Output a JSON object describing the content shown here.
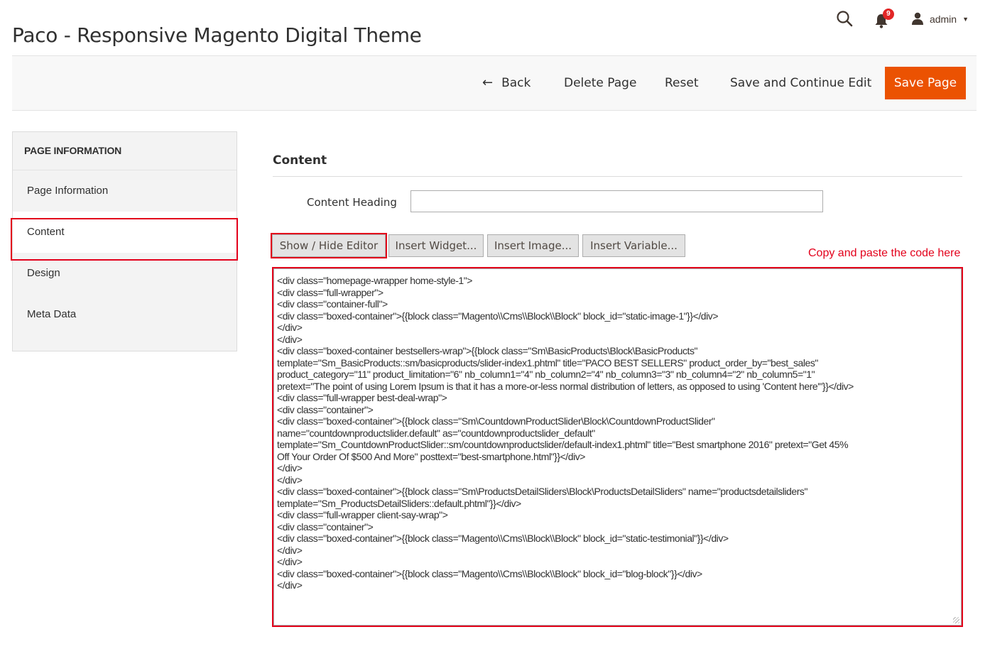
{
  "header": {
    "title": "Paco - Responsive Magento Digital Theme",
    "notifications_count": "9",
    "user_name": "admin"
  },
  "toolbar": {
    "back_label": "Back",
    "delete_label": "Delete Page",
    "reset_label": "Reset",
    "save_continue_label": "Save and Continue Edit",
    "save_label": "Save Page"
  },
  "sidebar": {
    "title": "PAGE INFORMATION",
    "items": [
      {
        "label": "Page Information"
      },
      {
        "label": "Content"
      },
      {
        "label": "Design"
      },
      {
        "label": "Meta Data"
      }
    ],
    "active_index": 1
  },
  "content": {
    "section_title": "Content",
    "heading_label": "Content Heading",
    "heading_value": "",
    "editor_buttons": {
      "show_hide": "Show / Hide Editor",
      "widget": "Insert Widget...",
      "image": "Insert Image...",
      "variable": "Insert Variable..."
    },
    "annotation": "Copy and paste the code here",
    "code": "<div class=\"homepage-wrapper home-style-1\">\n<div class=\"full-wrapper\">\n<div class=\"container-full\">\n<div class=\"boxed-container\">{{block class=\"Magento\\\\Cms\\\\Block\\\\Block\" block_id=\"static-image-1\"}}</div>\n</div>\n</div>\n<div class=\"boxed-container bestsellers-wrap\">{{block class=\"Sm\\BasicProducts\\Block\\BasicProducts\"\ntemplate=\"Sm_BasicProducts::sm/basicproducts/slider-index1.phtml\" title=\"PACO BEST SELLERS\" product_order_by=\"best_sales\"\nproduct_category=\"11\" product_limitation=\"6\" nb_column1=\"4\" nb_column2=\"4\" nb_column3=\"3\" nb_column4=\"2\" nb_column5=\"1\"\npretext=\"The point of using Lorem Ipsum is that it has a more-or-less normal distribution of letters, as opposed to using 'Content here'\"}}</div>\n<div class=\"full-wrapper best-deal-wrap\">\n<div class=\"container\">\n<div class=\"boxed-container\">{{block class=\"Sm\\CountdownProductSlider\\Block\\CountdownProductSlider\"\nname=\"countdownproductslider.default\" as=\"countdownproductslider_default\"\ntemplate=\"Sm_CountdownProductSlider::sm/countdownproductslider/default-index1.phtml\" title=\"Best smartphone 2016\" pretext=\"Get 45%\nOff Your Order Of $500 And More\" posttext=\"best-smartphone.html\"}}</div>\n</div>\n</div>\n<div class=\"boxed-container\">{{block class=\"Sm\\ProductsDetailSliders\\Block\\ProductsDetailSliders\" name=\"productsdetailsliders\"\ntemplate=\"Sm_ProductsDetailSliders::default.phtml\"}}</div>\n<div class=\"full-wrapper client-say-wrap\">\n<div class=\"container\">\n<div class=\"boxed-container\">{{block class=\"Magento\\\\Cms\\\\Block\\\\Block\" block_id=\"static-testimonial\"}}</div>\n</div>\n</div>\n<div class=\"boxed-container\">{{block class=\"Magento\\\\Cms\\\\Block\\\\Block\" block_id=\"blog-block\"}}</div>\n</div>"
  },
  "icons": {
    "search": "search-icon",
    "bell": "bell-icon",
    "user": "user-icon",
    "back": "arrow-left-icon"
  },
  "colors": {
    "accent": "#eb5202",
    "highlight": "#e3001b",
    "badge": "#e22626"
  }
}
